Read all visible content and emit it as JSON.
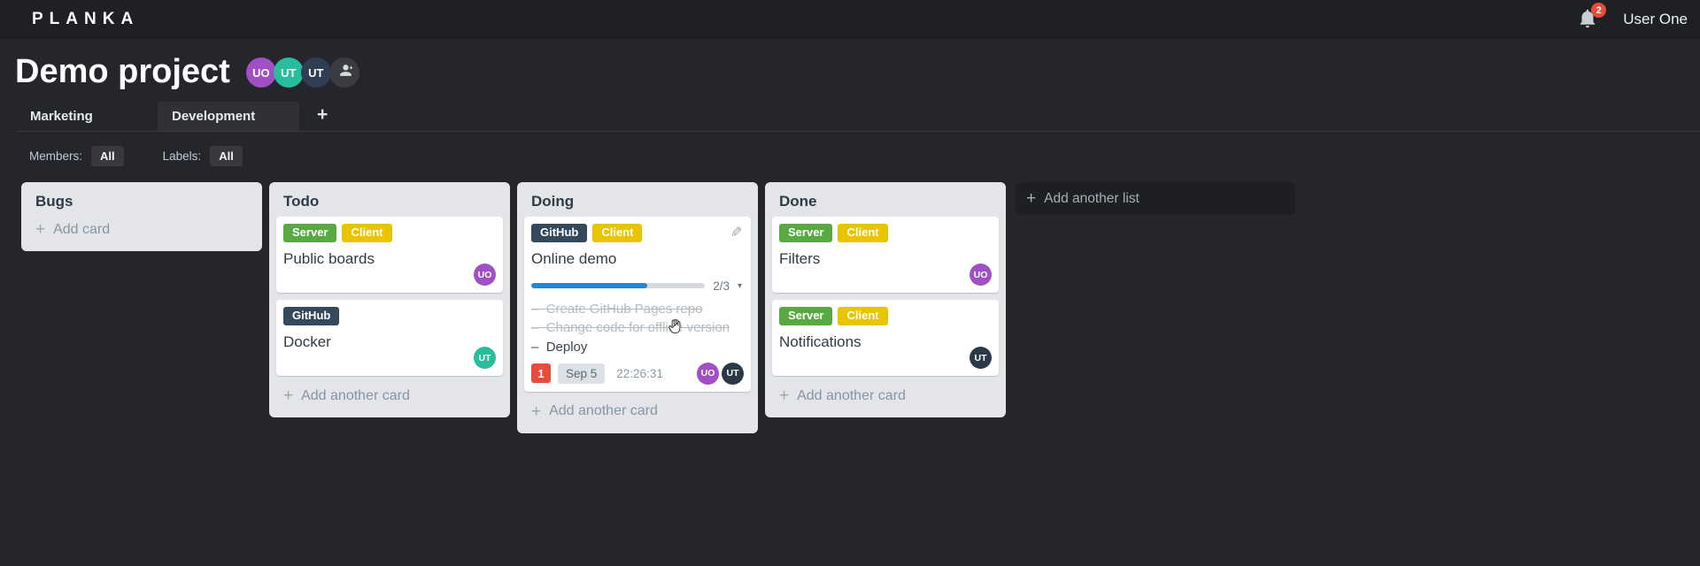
{
  "topbar": {
    "logo": "PLANKA",
    "notifications_count": "2",
    "user_name": "User One"
  },
  "project": {
    "title": "Demo project",
    "members": [
      {
        "initials": "UO",
        "color": "#a04fc4"
      },
      {
        "initials": "UT",
        "color": "#28bd9c"
      },
      {
        "initials": "UT",
        "color": "#2f3e51"
      }
    ]
  },
  "tabs": {
    "items": [
      {
        "label": "Marketing",
        "active": false
      },
      {
        "label": "Development",
        "active": true
      }
    ],
    "add_label": "+"
  },
  "filters": {
    "members_label": "Members:",
    "members_value": "All",
    "labels_label": "Labels:",
    "labels_value": "All"
  },
  "board": {
    "add_list_label": "Add another list",
    "lists": [
      {
        "title": "Bugs",
        "add_label": "Add card",
        "cards": []
      },
      {
        "title": "Todo",
        "add_label": "Add another card",
        "cards": [
          {
            "title": "Public boards",
            "labels": [
              {
                "text": "Server",
                "color": "#58a942"
              },
              {
                "text": "Client",
                "color": "#e9c500"
              }
            ],
            "members": [
              {
                "initials": "UO",
                "color": "#a04fc4"
              }
            ]
          },
          {
            "title": "Docker",
            "labels": [
              {
                "text": "GitHub",
                "color": "#35495c"
              }
            ],
            "members": [
              {
                "initials": "UT",
                "color": "#28bd9c"
              }
            ]
          }
        ]
      },
      {
        "title": "Doing",
        "add_label": "Add another card",
        "cards": [
          {
            "title": "Online demo",
            "labels": [
              {
                "text": "GitHub",
                "color": "#35495c"
              },
              {
                "text": "Client",
                "color": "#e9c500"
              }
            ],
            "progress": {
              "text": "2/3",
              "percent": 67,
              "color": "#2387d6"
            },
            "tasks": [
              {
                "text": "Create GitHub Pages repo",
                "done": true
              },
              {
                "text": "Change code for offline version",
                "done": true
              },
              {
                "text": "Deploy",
                "done": false
              }
            ],
            "notification_count": "1",
            "due_date": "Sep 5",
            "timer": "22:26:31",
            "members": [
              {
                "initials": "UO",
                "color": "#a04fc4"
              },
              {
                "initials": "UT",
                "color": "#2a3848"
              }
            ]
          }
        ]
      },
      {
        "title": "Done",
        "add_label": "Add another card",
        "cards": [
          {
            "title": "Filters",
            "labels": [
              {
                "text": "Server",
                "color": "#58a942"
              },
              {
                "text": "Client",
                "color": "#e9c500"
              }
            ],
            "members": [
              {
                "initials": "UO",
                "color": "#a04fc4"
              }
            ]
          },
          {
            "title": "Notifications",
            "labels": [
              {
                "text": "Server",
                "color": "#58a942"
              },
              {
                "text": "Client",
                "color": "#e9c500"
              }
            ],
            "members": [
              {
                "initials": "UT",
                "color": "#2a3848"
              }
            ]
          }
        ]
      }
    ]
  }
}
